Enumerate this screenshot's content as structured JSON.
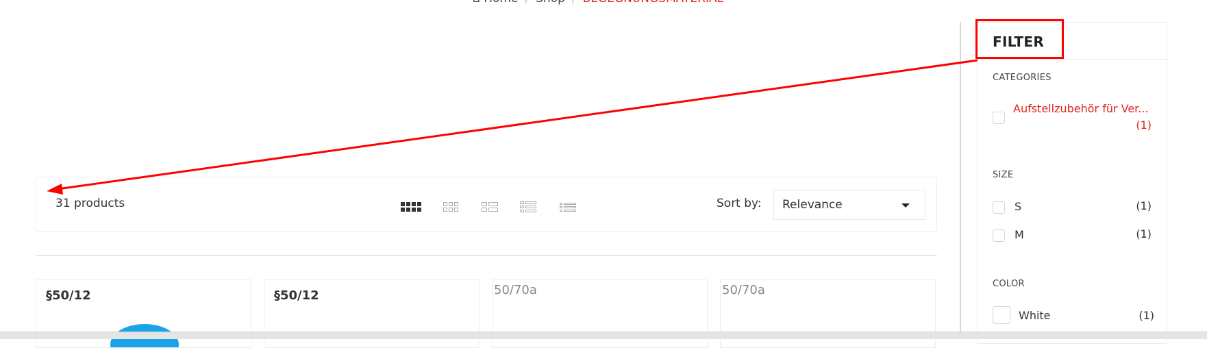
{
  "breadcrumb": {
    "home": "Home",
    "shop": "Shop",
    "current": "BEGEGNUNGSMATERIAL"
  },
  "toolbar": {
    "count": "31 products",
    "sort_label": "Sort by:",
    "sort_value": "Relevance",
    "view_icons": [
      "grid-4-icon",
      "grid-3-icon",
      "list-2-icon",
      "list-grid-icon",
      "list-icon"
    ]
  },
  "products": [
    {
      "title": "§50/12"
    },
    {
      "title": "§50/12"
    },
    {
      "title": "50/70a"
    },
    {
      "title": "50/70a"
    }
  ],
  "filter": {
    "title": "FILTER",
    "categories": {
      "label": "CATEGORIES",
      "items": [
        {
          "name": "Aufstellzubehör für Ver...",
          "count": "(1)"
        }
      ]
    },
    "size": {
      "label": "SIZE",
      "items": [
        {
          "name": "S",
          "count": "(1)"
        },
        {
          "name": "M",
          "count": "(1)"
        }
      ]
    },
    "color": {
      "label": "COLOR",
      "items": [
        {
          "name": "White",
          "count": "(1)"
        }
      ]
    }
  },
  "colors": {
    "accent": "#e2211c",
    "annotation": "#ff0000",
    "product_blue": "#1aa3e8"
  }
}
